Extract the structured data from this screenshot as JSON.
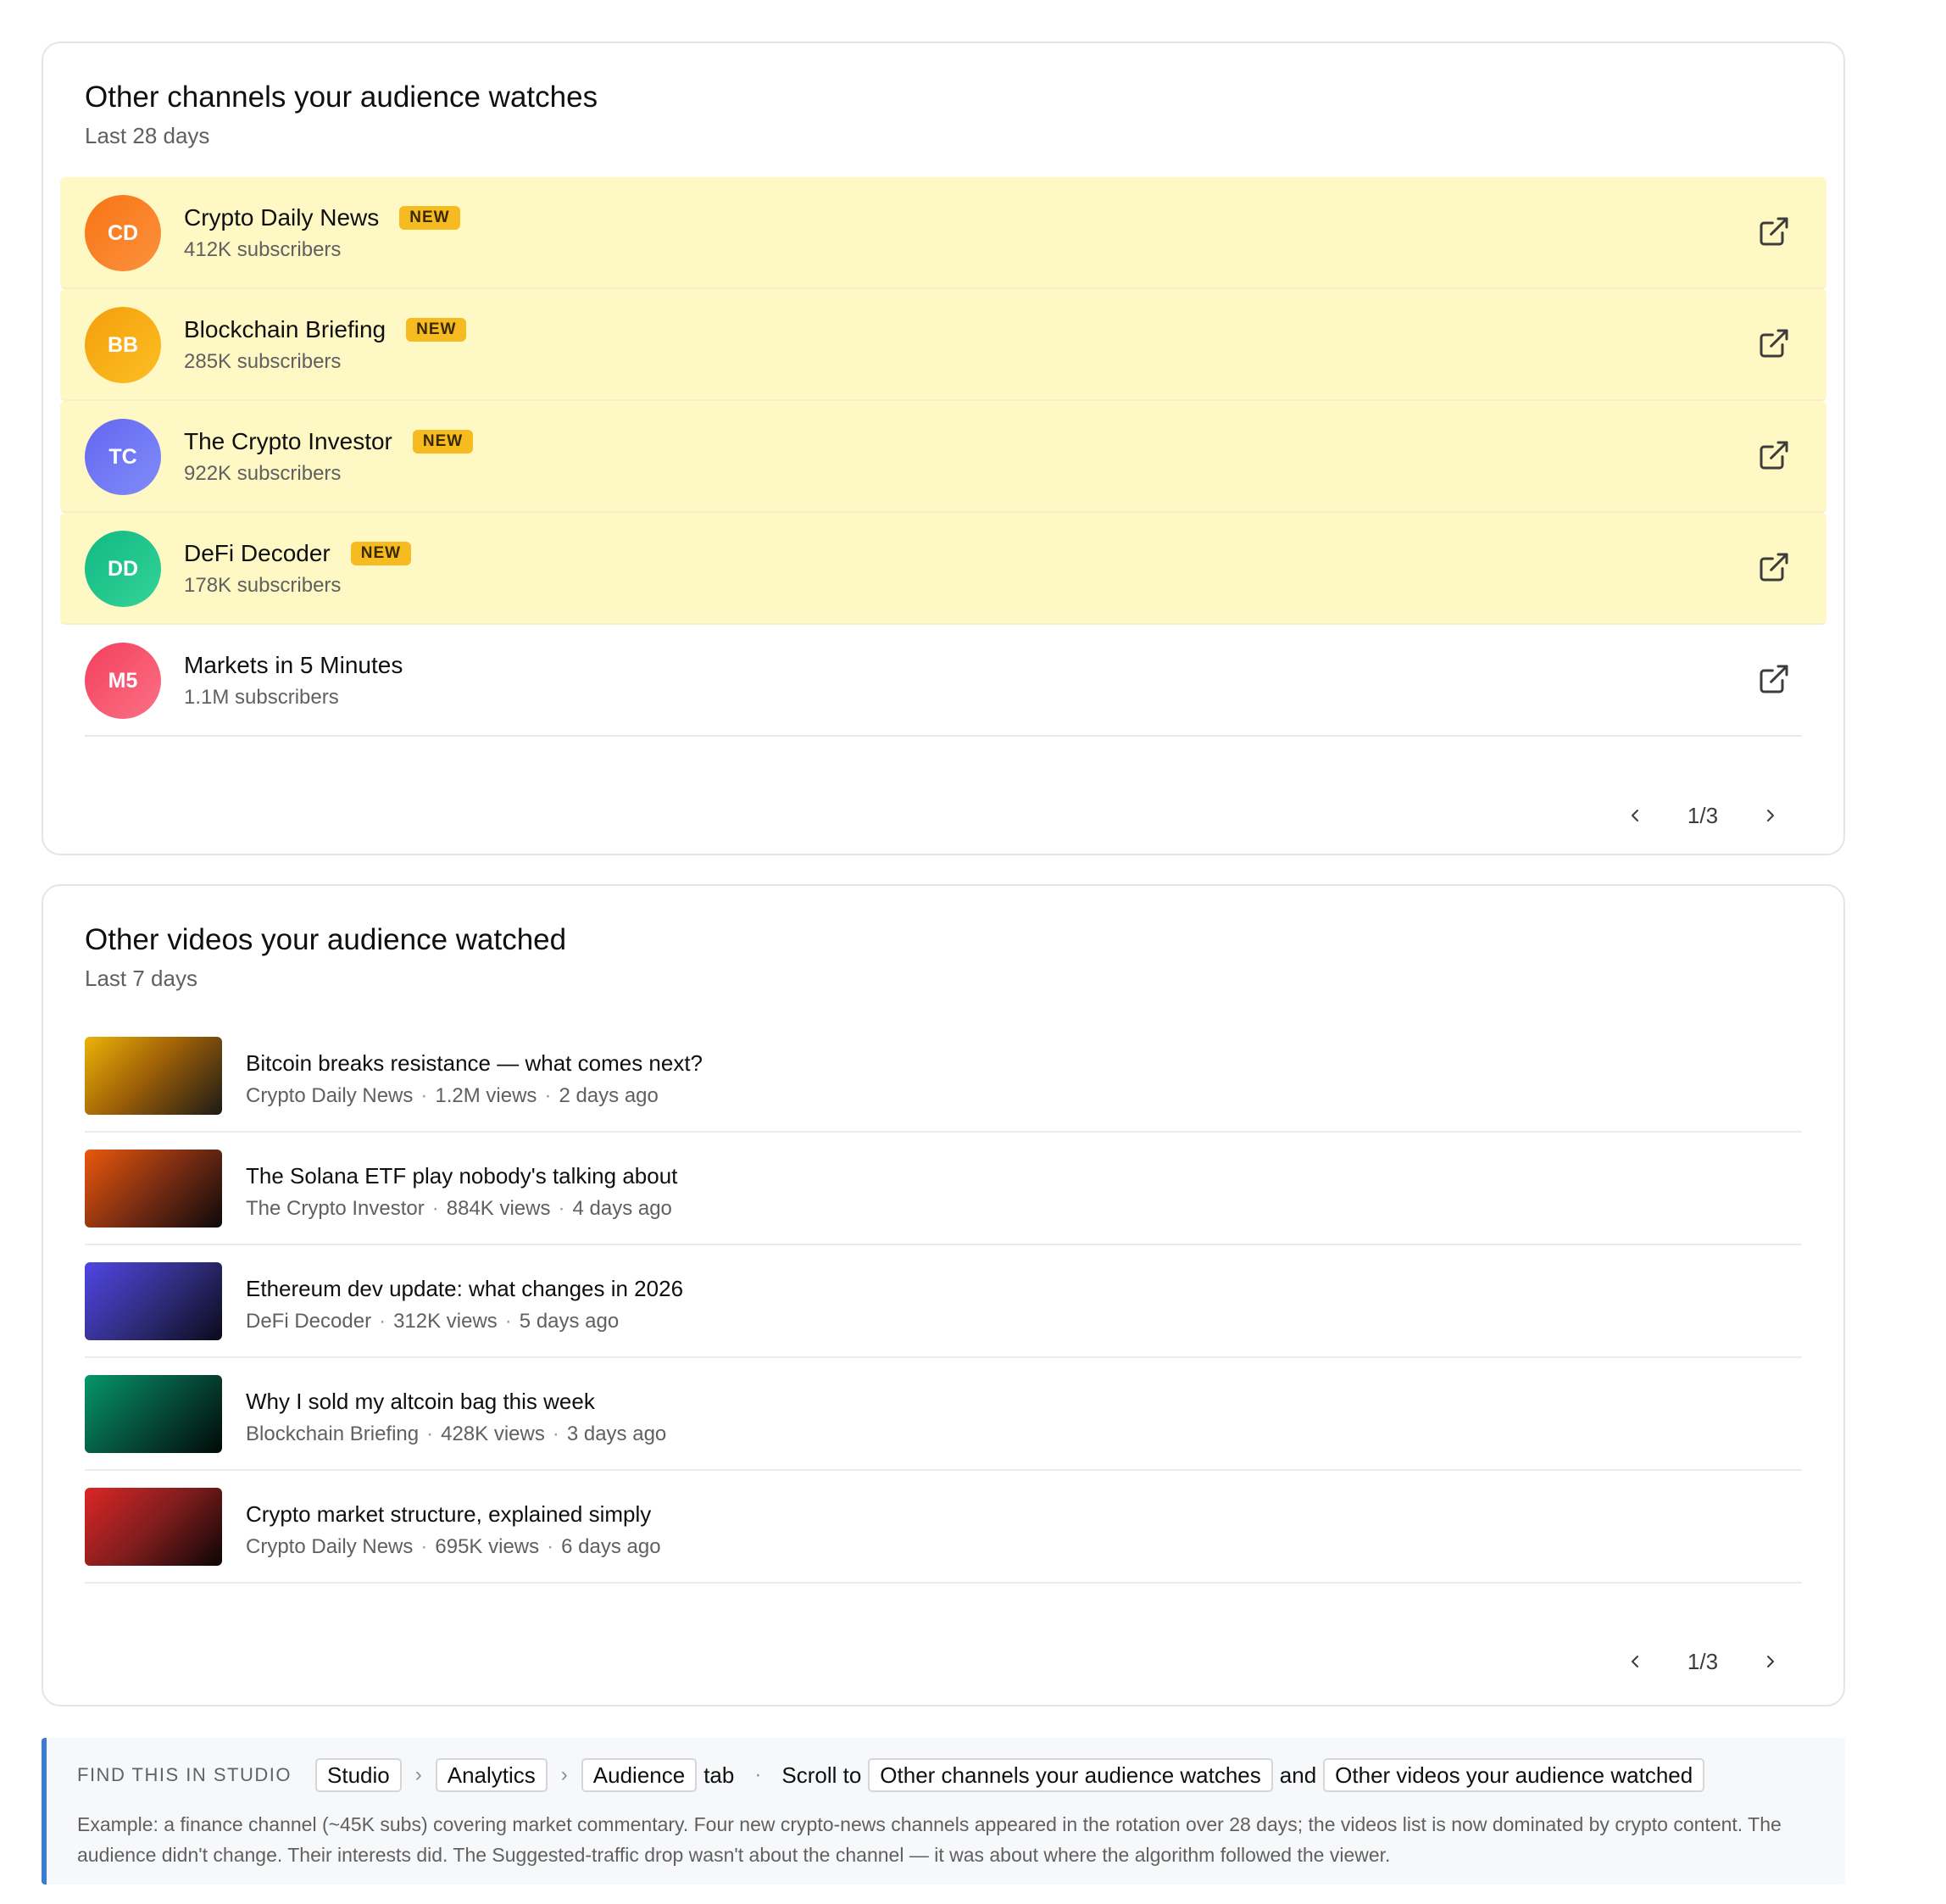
{
  "channels_card": {
    "title": "Other channels your audience watches",
    "subtitle": "Last 28 days",
    "items": [
      {
        "initials": "CD",
        "name": "Crypto Daily News",
        "badge": "NEW",
        "subs": "412K subscribers",
        "color": "#f97316"
      },
      {
        "initials": "BB",
        "name": "Blockchain Briefing",
        "badge": "NEW",
        "subs": "285K subscribers",
        "color": "#f59e0b"
      },
      {
        "initials": "TC",
        "name": "The Crypto Investor",
        "badge": "NEW",
        "subs": "922K subscribers",
        "color": "#6366f1"
      },
      {
        "initials": "DD",
        "name": "DeFi Decoder",
        "badge": "NEW",
        "subs": "178K subscribers",
        "color": "#10b981"
      },
      {
        "initials": "M5",
        "name": "Markets in 5 Minutes",
        "badge": "",
        "subs": "1.1M subscribers",
        "color": "#f43f5e"
      }
    ],
    "page": "1/3"
  },
  "videos_card": {
    "title": "Other videos your audience watched",
    "subtitle": "Last 7 days",
    "items": [
      {
        "title": "Bitcoin breaks resistance — what comes next?",
        "channel": "Crypto Daily News",
        "views": "1.2M views",
        "age": "2 days ago",
        "color": "#eab308"
      },
      {
        "title": "The Solana ETF play nobody's talking about",
        "channel": "The Crypto Investor",
        "views": "884K views",
        "age": "4 days ago",
        "color": "#ea580c"
      },
      {
        "title": "Ethereum dev update: what changes in 2026",
        "channel": "DeFi Decoder",
        "views": "312K views",
        "age": "5 days ago",
        "color": "#4f46e5"
      },
      {
        "title": "Why I sold my altcoin bag this week",
        "channel": "Blockchain Briefing",
        "views": "428K views",
        "age": "3 days ago",
        "color": "#059669"
      },
      {
        "title": "Crypto market structure, explained simply",
        "channel": "Crypto Daily News",
        "views": "695K views",
        "age": "6 days ago",
        "color": "#dc2626"
      }
    ],
    "page": "1/3"
  },
  "studio_note": {
    "label": "FIND THIS IN STUDIO",
    "path": [
      "Studio",
      "Analytics",
      "Audience"
    ],
    "tab_word": "tab",
    "scroll_to": "Scroll to",
    "target_1": "Other channels your audience watches",
    "and_word": "and",
    "target_2": "Other videos your audience watched",
    "example": "Example: a finance channel (~45K subs) covering market commentary. Four new crypto-news channels appeared in the rotation over 28 days; the videos list is now dominated by crypto content. The audience didn't change. Their interests did. The Suggested-traffic drop wasn't about the channel — it was about where the algorithm followed the viewer."
  },
  "colors": {
    "new_row_bg": "#fef8c4",
    "badge_bg": "#f6bb21",
    "note_accent": "#3a7bd5"
  }
}
